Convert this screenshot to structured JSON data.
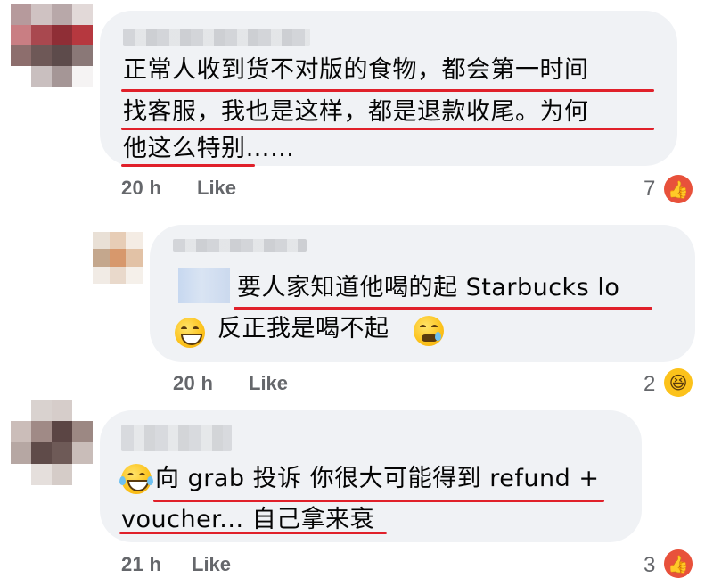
{
  "comments": [
    {
      "lines": [
        "正常人收到货不对版的食物，都会第一时间",
        "找客服，我也是这样，都是退款收尾。为何",
        "他这么特别……"
      ],
      "time": "20 h",
      "like_label": "Like",
      "reaction_count": "7",
      "reaction_icon": "thumbs-up"
    },
    {
      "lines": [
        "要人家知道他喝的起 Starbucks lo",
        "反正我是喝不起"
      ],
      "time": "20 h",
      "like_label": "Like",
      "reaction_count": "2",
      "reaction_icon": "haha"
    },
    {
      "lines": [
        "向 grab 投诉 你很大可能得到 refund +",
        "voucher... 自己拿来衰"
      ],
      "time": "21 h",
      "like_label": "Like",
      "reaction_count": "3",
      "reaction_icon": "thumbs-up"
    }
  ],
  "colors": {
    "bubble": "#f0f2f5",
    "underline": "#e0202a",
    "meta_text": "#65676b",
    "like_reaction": "#e8513b",
    "haha_reaction": "#fcc21b"
  },
  "icons": {
    "grin_emoji": "😁",
    "sleepy_emoji": "😪",
    "joy_emoji": "😂",
    "thumbs_up": "👍",
    "haha": "😆"
  }
}
